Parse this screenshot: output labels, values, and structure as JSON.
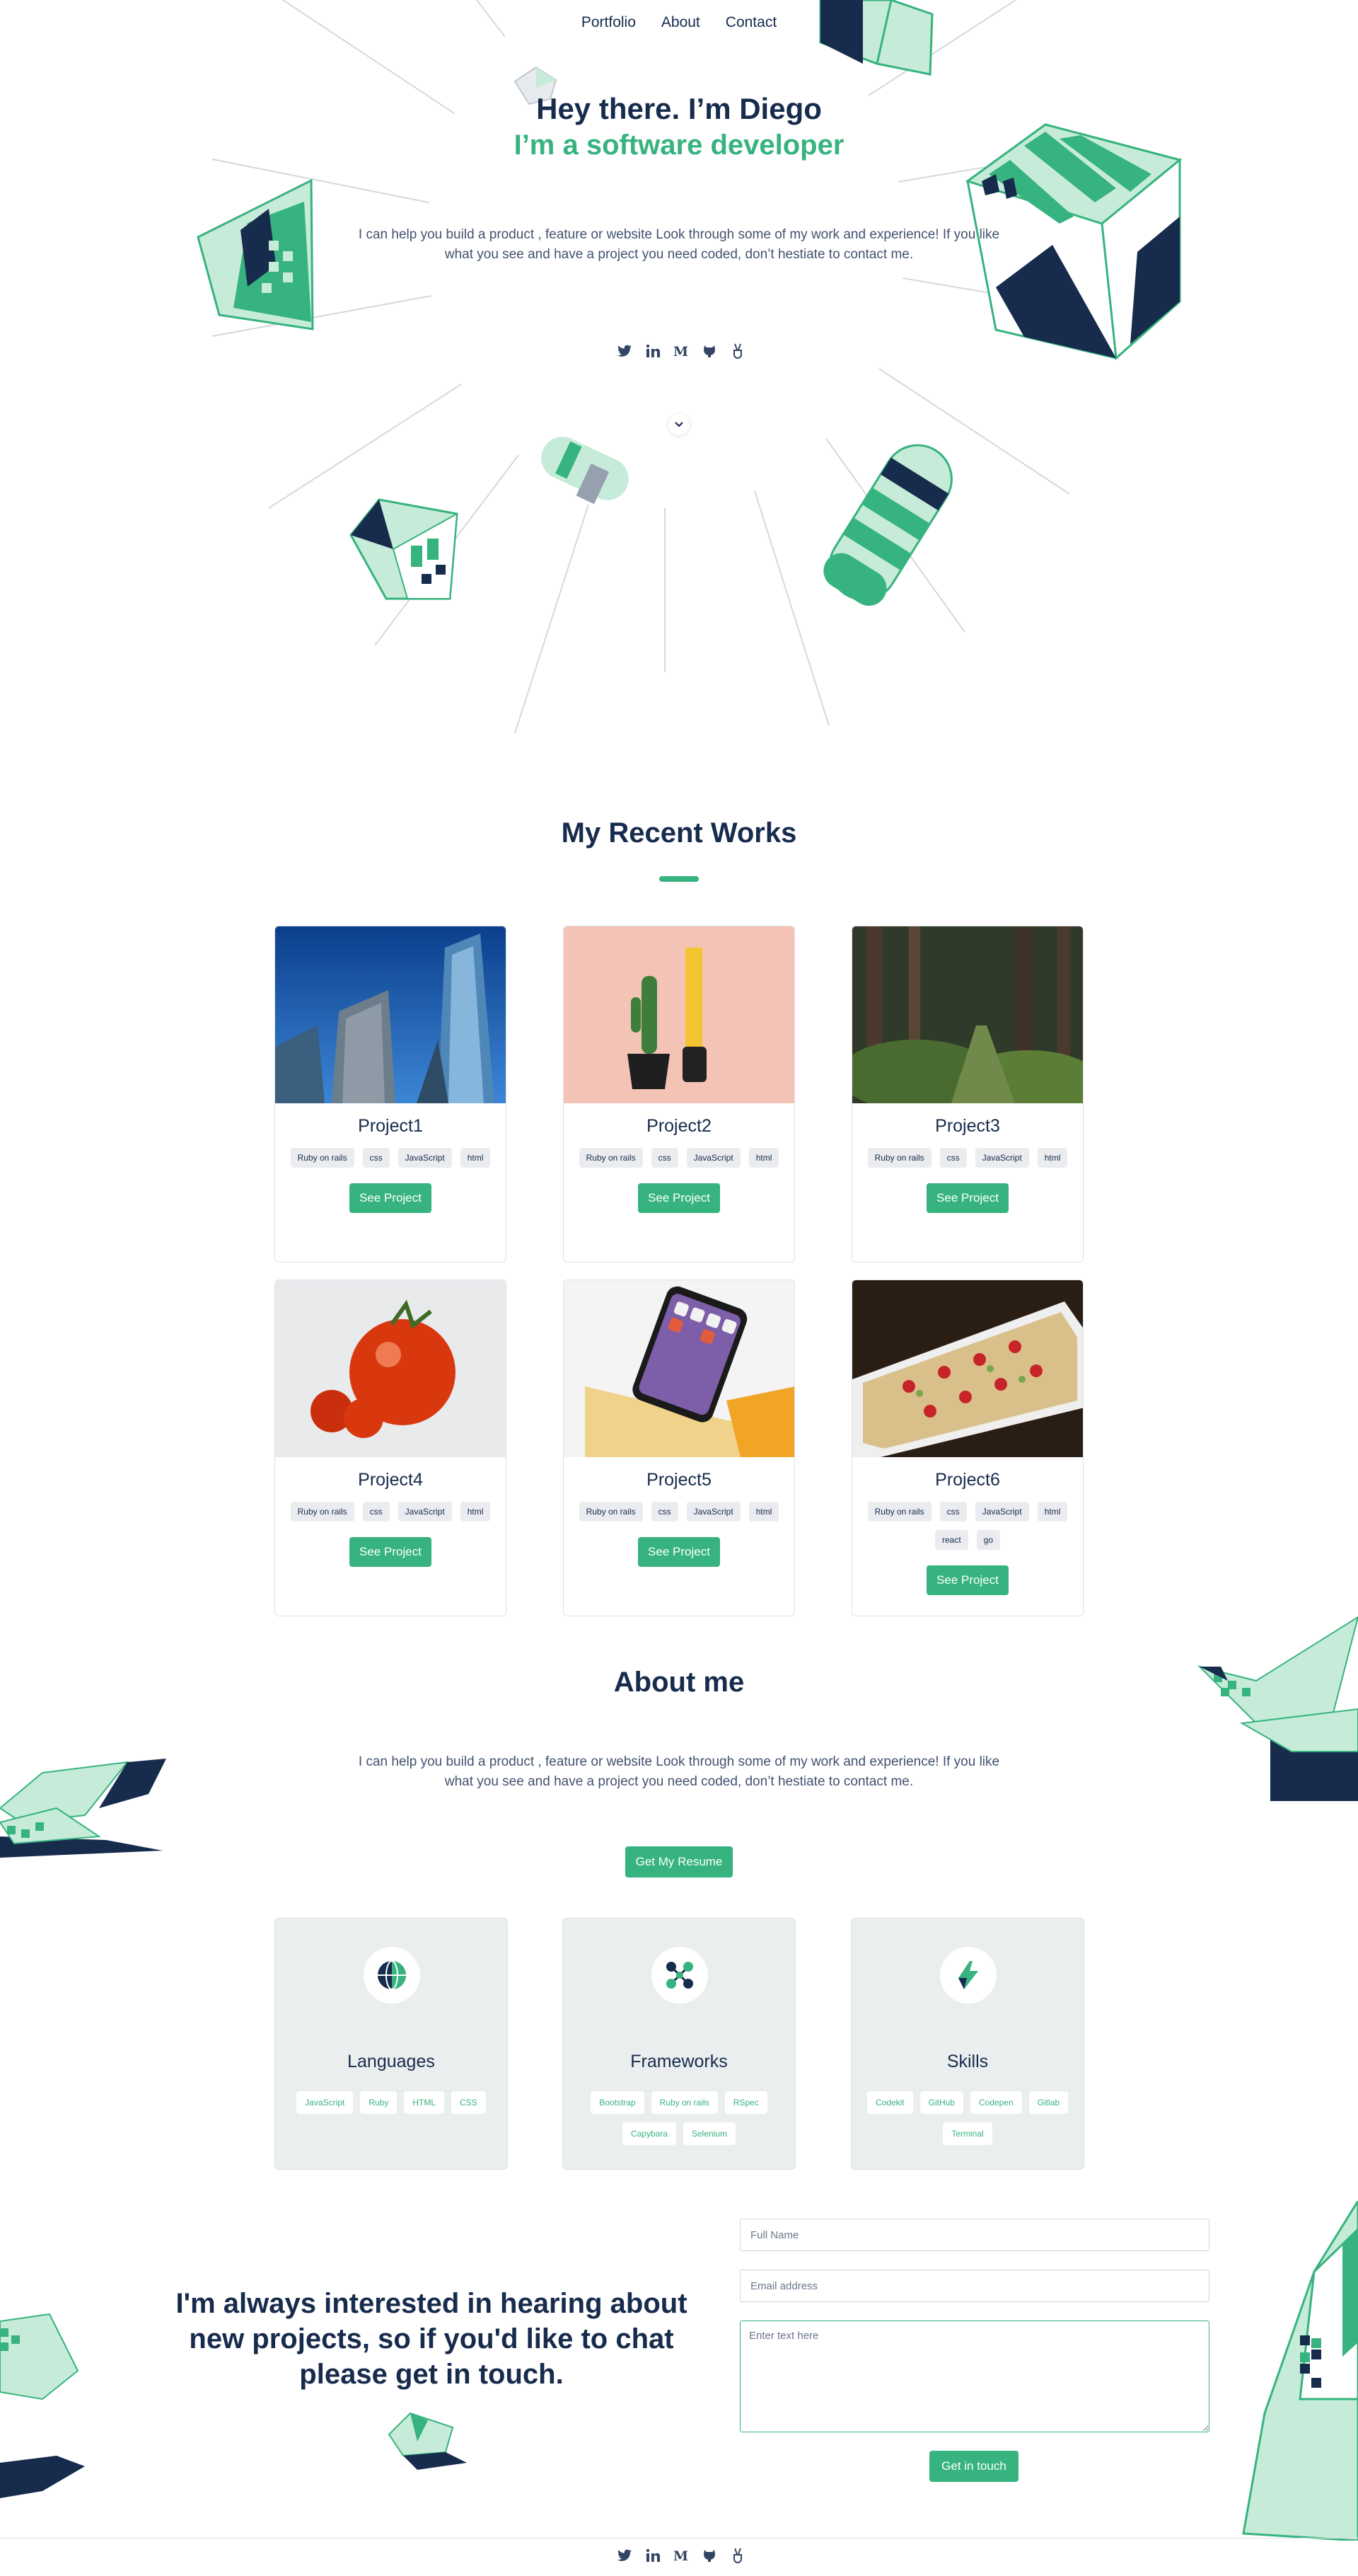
{
  "nav": {
    "items": [
      {
        "label": "Portfolio"
      },
      {
        "label": "About"
      },
      {
        "label": "Contact"
      }
    ]
  },
  "hero": {
    "title": "Hey there. I’m Diego",
    "subtitle": "I’m a software developer",
    "description": "I can help you build a product , feature or website Look through some of my work and experience! If you like what you see and have a project you need coded, don’t hestiate to contact me."
  },
  "socials": [
    {
      "icon": "twitter-icon"
    },
    {
      "icon": "linkedin-icon"
    },
    {
      "icon": "medium-icon"
    },
    {
      "icon": "github-icon"
    },
    {
      "icon": "angellist-icon"
    }
  ],
  "works": {
    "title": "My Recent Works",
    "see_label": "See Project",
    "projects": [
      {
        "title": "Project1",
        "tags": [
          "Ruby on rails",
          "css",
          "JavaScript",
          "html"
        ],
        "image": "city-skyscrapers"
      },
      {
        "title": "Project2",
        "tags": [
          "Ruby on rails",
          "css",
          "JavaScript",
          "html"
        ],
        "image": "cactus-tape-measure"
      },
      {
        "title": "Project3",
        "tags": [
          "Ruby on rails",
          "css",
          "JavaScript",
          "html"
        ],
        "image": "forest-path"
      },
      {
        "title": "Project4",
        "tags": [
          "Ruby on rails",
          "css",
          "JavaScript",
          "html"
        ],
        "image": "tomatoes"
      },
      {
        "title": "Project5",
        "tags": [
          "Ruby on rails",
          "css",
          "JavaScript",
          "html"
        ],
        "image": "phone-tape-measure"
      },
      {
        "title": "Project6",
        "tags": [
          "Ruby on rails",
          "css",
          "JavaScript",
          "html",
          "react",
          "go"
        ],
        "image": "appetizers"
      }
    ]
  },
  "about": {
    "title": "About me",
    "description": "I can help you build a product , feature or website Look through some of my work and experience! If you like what you see and have a project you need coded, don’t hestiate to contact me.",
    "resume_label": "Get My Resume",
    "skills": [
      {
        "title": "Languages",
        "icon": "globe-icon",
        "tags": [
          "JavaScript",
          "Ruby",
          "HTML",
          "CSS"
        ]
      },
      {
        "title": "Frameworks",
        "icon": "nodes-icon",
        "tags": [
          "Bootstrap",
          "Ruby on rails",
          "RSpec",
          "Capybara",
          "Selenium"
        ]
      },
      {
        "title": "Skills",
        "icon": "lightning-icon",
        "tags": [
          "Codekit",
          "GitHub",
          "Codepen",
          "Gitlab",
          "Terminal"
        ]
      }
    ]
  },
  "contact": {
    "text": "I'm always interested in hearing about new projects, so if you'd like to chat please get in touch.",
    "name_placeholder": "Full Name",
    "email_placeholder": "Email address",
    "message_placeholder": "Enter text here",
    "submit_label": "Get in touch"
  },
  "colors": {
    "accent": "#36b37e",
    "accent_light": "#c6ecd9",
    "navy": "#172b4d",
    "text_muted": "#42526e"
  }
}
